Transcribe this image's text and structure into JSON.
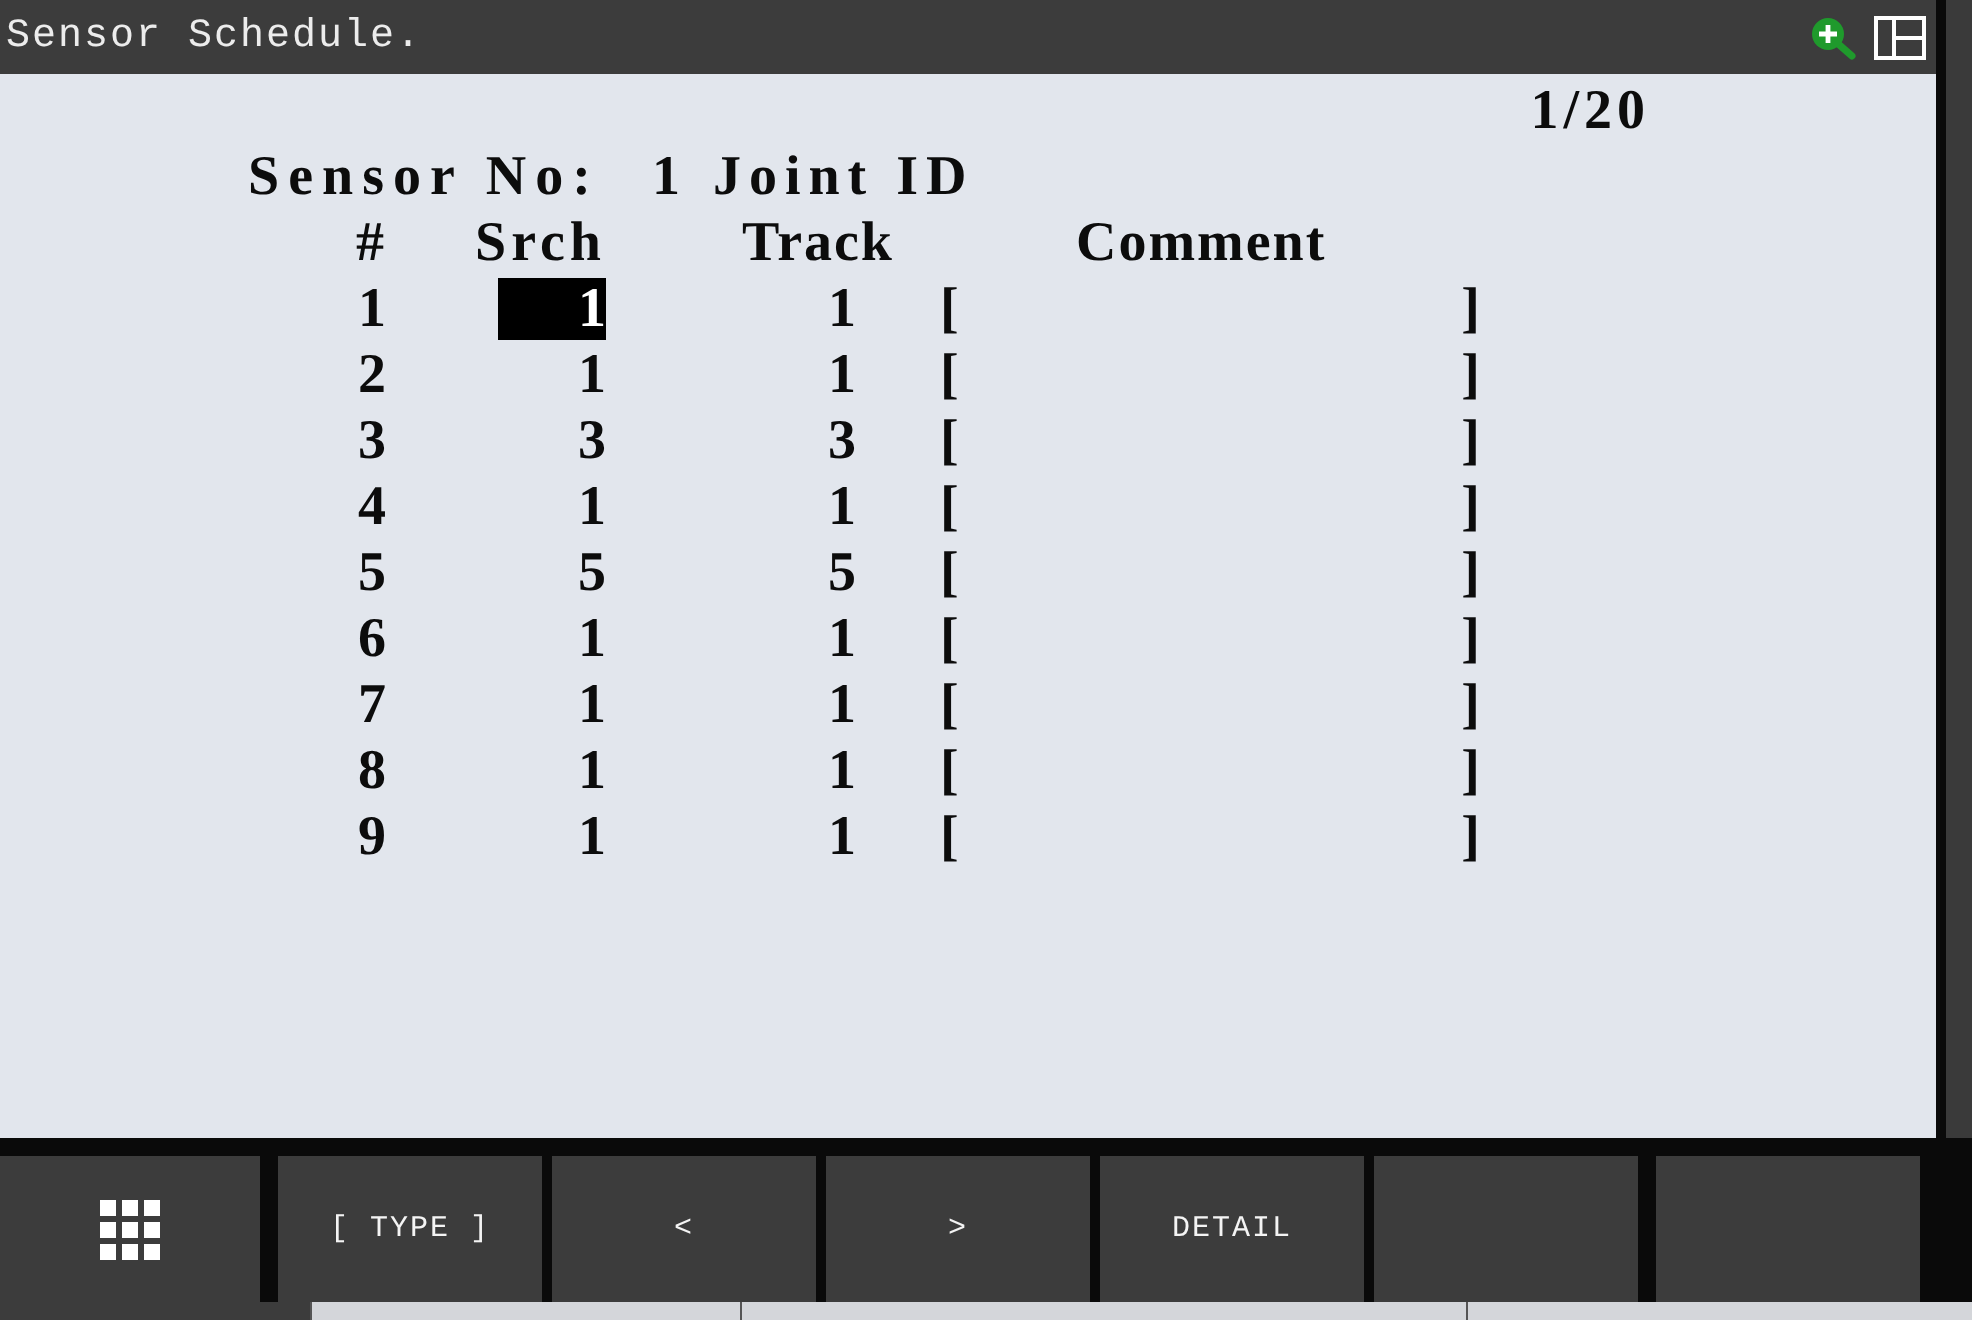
{
  "window": {
    "title": "Sensor Schedule."
  },
  "page_indicator": "1/20",
  "sensor": {
    "label": "Sensor No:",
    "number": "1",
    "joint_id_label": "Joint ID"
  },
  "table": {
    "columns": [
      {
        "kind": "number",
        "label": "#"
      },
      {
        "kind": "srch",
        "label": "Srch"
      },
      {
        "kind": "track",
        "label": "Track"
      },
      {
        "kind": "comment",
        "label": "Comment"
      }
    ],
    "rows": [
      {
        "number": "1",
        "srch": {
          "value": "1",
          "selected": true
        },
        "track": {
          "value": "1",
          "selected": false
        },
        "comment": {
          "open": "[",
          "close": "]"
        }
      },
      {
        "number": "2",
        "srch": {
          "value": "1",
          "selected": false
        },
        "track": {
          "value": "1",
          "selected": false
        },
        "comment": {
          "open": "[",
          "close": "]"
        }
      },
      {
        "number": "3",
        "srch": {
          "value": "3",
          "selected": false
        },
        "track": {
          "value": "3",
          "selected": false
        },
        "comment": {
          "open": "[",
          "close": "]"
        }
      },
      {
        "number": "4",
        "srch": {
          "value": "1",
          "selected": false
        },
        "track": {
          "value": "1",
          "selected": false
        },
        "comment": {
          "open": "[",
          "close": "]"
        }
      },
      {
        "number": "5",
        "srch": {
          "value": "5",
          "selected": false
        },
        "track": {
          "value": "5",
          "selected": false
        },
        "comment": {
          "open": "[",
          "close": "]"
        }
      },
      {
        "number": "6",
        "srch": {
          "value": "1",
          "selected": false
        },
        "track": {
          "value": "1",
          "selected": false
        },
        "comment": {
          "open": "[",
          "close": "]"
        }
      },
      {
        "number": "7",
        "srch": {
          "value": "1",
          "selected": false
        },
        "track": {
          "value": "1",
          "selected": false
        },
        "comment": {
          "open": "[",
          "close": "]"
        }
      },
      {
        "number": "8",
        "srch": {
          "value": "1",
          "selected": false
        },
        "track": {
          "value": "1",
          "selected": false
        },
        "comment": {
          "open": "[",
          "close": "]"
        }
      },
      {
        "number": "9",
        "srch": {
          "value": "1",
          "selected": false
        },
        "track": {
          "value": "1",
          "selected": false
        },
        "comment": {
          "open": "[",
          "close": "]"
        }
      }
    ]
  },
  "function_keys": [
    {
      "kind": "menu"
    },
    {
      "kind": "label",
      "label": "[ TYPE ]"
    },
    {
      "kind": "label",
      "label": "<"
    },
    {
      "kind": "label",
      "label": ">"
    },
    {
      "kind": "label",
      "label": "DETAIL"
    },
    {
      "kind": "blank"
    },
    {
      "kind": "blank"
    }
  ]
}
